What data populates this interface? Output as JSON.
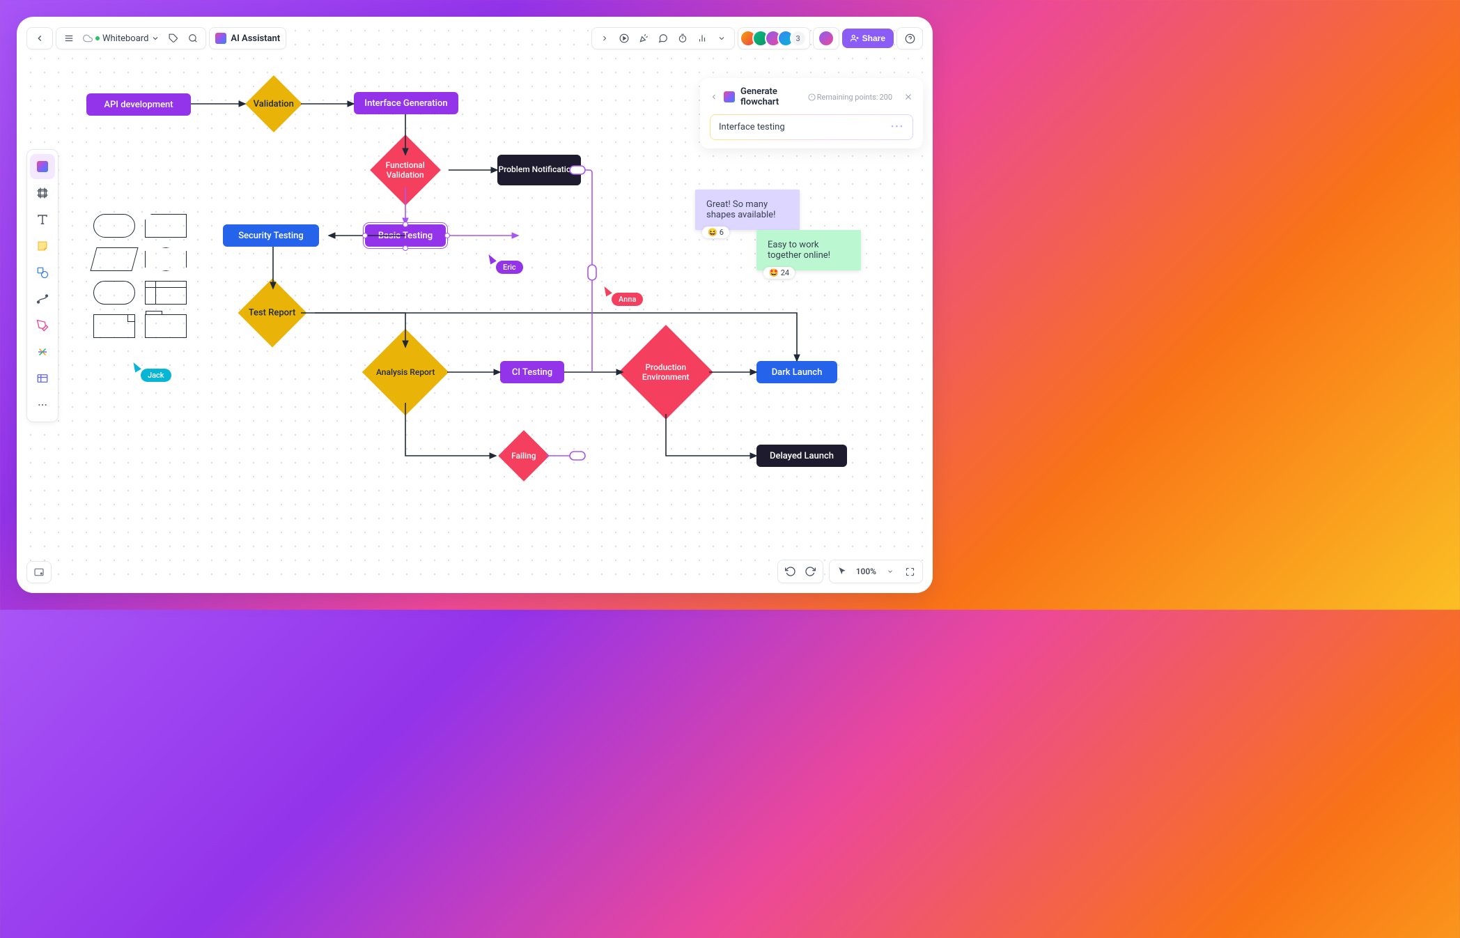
{
  "header": {
    "doc_name": "Whiteboard",
    "ai_assistant": "AI Assistant",
    "avatar_overflow": "3",
    "share": "Share"
  },
  "ai_panel": {
    "title": "Generate flowchart",
    "points_label": "Remaining points:",
    "points_value": "200",
    "input_value": "Interface testing"
  },
  "nodes": {
    "api_dev": "API development",
    "validation": "Validation",
    "interface_gen": "Interface Generation",
    "func_val": "Functional Validation",
    "problem_notif": "Problem Notifications",
    "sec_test": "Security Testing",
    "basic_test": "Basic Testing",
    "test_report": "Test Report",
    "analysis_report": "Analysis Report",
    "ci_testing": "CI Testing",
    "prod_env": "Production Environment",
    "dark_launch": "Dark Launch",
    "failing": "Failing",
    "delayed_launch": "Delayed Launch"
  },
  "cursors": {
    "jack": "Jack",
    "eric": "Eric",
    "anna": "Anna"
  },
  "stickies": {
    "s1": "Great! So many shapes available!",
    "s1_react": "6",
    "s2": "Easy to work together online!",
    "s2_react": "24"
  },
  "footer": {
    "zoom": "100%"
  }
}
